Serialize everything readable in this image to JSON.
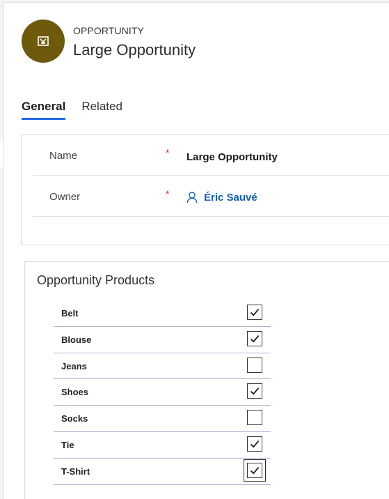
{
  "header": {
    "entity_type": "OPPORTUNITY",
    "title": "Large Opportunity",
    "avatar_color": "#6e5a0b",
    "avatar_icon": "opportunity-icon"
  },
  "tabs": [
    {
      "label": "General",
      "active": true
    },
    {
      "label": "Related",
      "active": false
    }
  ],
  "general": {
    "fields": [
      {
        "label": "Name",
        "required_mark": "*",
        "value": "Large Opportunity"
      },
      {
        "label": "Owner",
        "required_mark": "*",
        "value": "Éric Sauvé",
        "icon": "person-icon"
      }
    ]
  },
  "products": {
    "title": "Opportunity Products",
    "items": [
      {
        "name": "Belt",
        "checked": true
      },
      {
        "name": "Blouse",
        "checked": true
      },
      {
        "name": "Jeans",
        "checked": false
      },
      {
        "name": "Shoes",
        "checked": true
      },
      {
        "name": "Socks",
        "checked": false
      },
      {
        "name": "Tie",
        "checked": true
      },
      {
        "name": "T-Shirt",
        "checked": true,
        "focused": true
      }
    ]
  },
  "colors": {
    "accent": "#2266e3",
    "link": "#1160b7",
    "required": "#c4262e"
  }
}
